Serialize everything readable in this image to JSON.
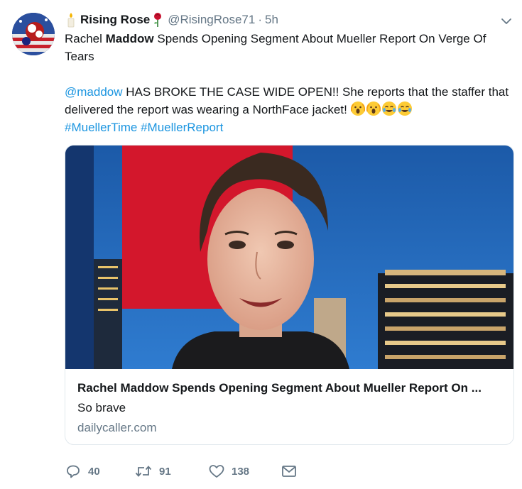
{
  "tweet": {
    "display_name": "Rising Rose",
    "handle": "@RisingRose71",
    "separator": "·",
    "time": "5h",
    "headline_pre": "Rachel ",
    "headline_bold": "Maddow",
    "headline_post": " Spends Opening Segment About Mueller Report On Verge Of Tears",
    "mention": "@maddow",
    "body": " HAS BROKE THE CASE WIDE OPEN!! She reports that the staffer that delivered the report was wearing a NorthFace jacket! ",
    "hashtag1": "#MuellerTime",
    "hashtag2": "#MuellerReport",
    "emojis": [
      "scream-face-emoji",
      "scream-face-emoji",
      "tears-of-joy-emoji",
      "tears-of-joy-emoji"
    ]
  },
  "card": {
    "title": "Rachel Maddow Spends Opening Segment About Mueller Report On ...",
    "description": "So brave",
    "domain": "dailycaller.com"
  },
  "actions": {
    "replies": "40",
    "retweets": "91",
    "likes": "138"
  },
  "colors": {
    "link": "#1b95e0",
    "muted": "#657786",
    "text": "#14171a",
    "border": "#e1e8ed"
  }
}
